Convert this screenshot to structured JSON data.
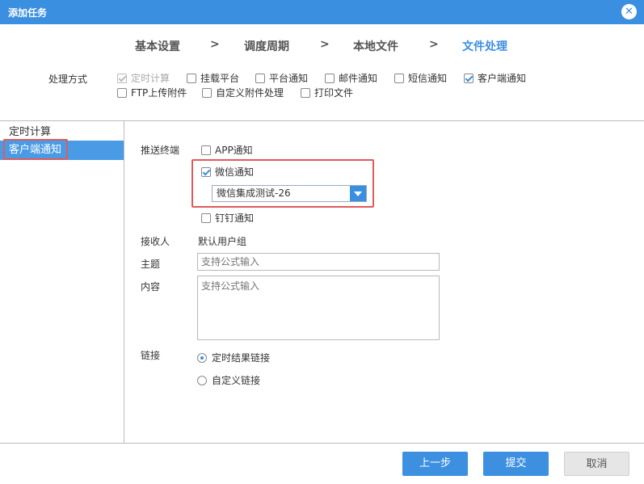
{
  "window": {
    "title": "添加任务"
  },
  "steps": [
    "基本设置",
    "调度周期",
    "本地文件",
    "文件处理"
  ],
  "step_separator": ">",
  "mode": {
    "label": "处理方式",
    "options": [
      {
        "label": "定时计算",
        "checked": true,
        "disabled": true
      },
      {
        "label": "挂载平台",
        "checked": false
      },
      {
        "label": "平台通知",
        "checked": false
      },
      {
        "label": "邮件通知",
        "checked": false
      },
      {
        "label": "短信通知",
        "checked": false
      },
      {
        "label": "客户端通知",
        "checked": true
      },
      {
        "label": "FTP上传附件",
        "checked": false
      },
      {
        "label": "自定义附件处理",
        "checked": false
      },
      {
        "label": "打印文件",
        "checked": false
      }
    ]
  },
  "sidebar": {
    "items": [
      "定时计算",
      "客户端通知"
    ],
    "selected": 1
  },
  "form": {
    "push_label": "推送终端",
    "push_options": [
      {
        "label": "APP通知",
        "checked": false
      },
      {
        "label": "微信通知",
        "checked": true
      },
      {
        "label": "钉钉通知",
        "checked": false
      }
    ],
    "wechat_select": "微信集成测试-26",
    "recipient_label": "接收人",
    "recipient_value": "默认用户组",
    "subject_label": "主题",
    "subject_placeholder": "支持公式输入",
    "content_label": "内容",
    "content_placeholder": "支持公式输入",
    "link_label": "链接",
    "link_options": [
      {
        "label": "定时结果链接",
        "selected": true
      },
      {
        "label": "自定义链接",
        "selected": false
      }
    ]
  },
  "buttons": {
    "prev": "上一步",
    "submit": "提交",
    "cancel": "取消"
  },
  "colors": {
    "accent": "#3b8fe0",
    "highlight_border": "#e05a5a"
  }
}
